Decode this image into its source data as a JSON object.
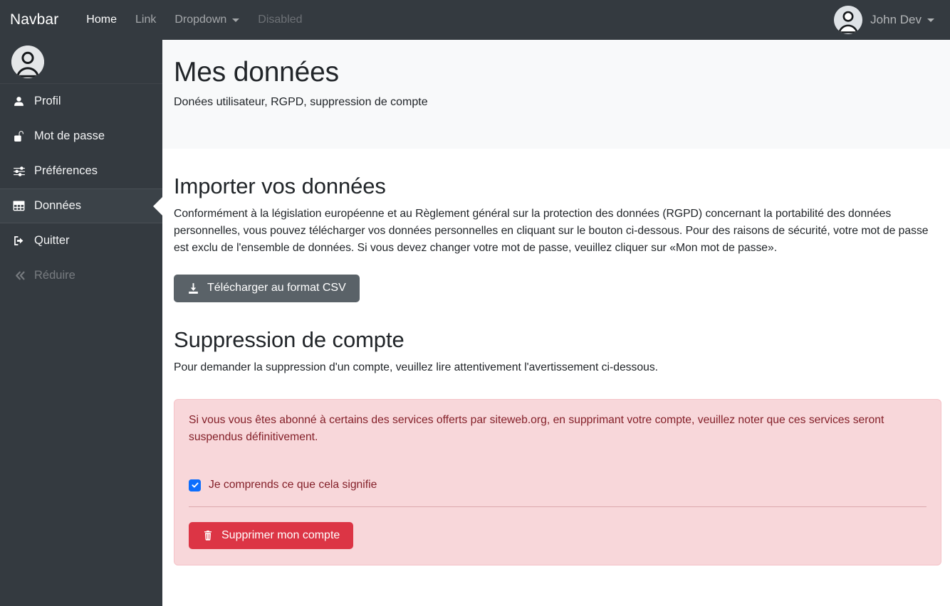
{
  "navbar": {
    "brand": "Navbar",
    "links": [
      {
        "label": "Home",
        "state": "active",
        "icon": ""
      },
      {
        "label": "Link",
        "state": "normal",
        "icon": ""
      },
      {
        "label": "Dropdown",
        "state": "normal",
        "icon": "chevron-down-icon"
      },
      {
        "label": "Disabled",
        "state": "disabled",
        "icon": ""
      }
    ],
    "user": {
      "name": "John Dev",
      "avatar_icon": "user-avatar-icon",
      "caret_icon": "chevron-down-icon"
    }
  },
  "sidebar": {
    "avatar_icon": "user-avatar-icon",
    "items": [
      {
        "label": "Profil",
        "icon": "user-icon",
        "state": "normal"
      },
      {
        "label": "Mot de passe",
        "icon": "unlock-icon",
        "state": "normal"
      },
      {
        "label": "Préférences",
        "icon": "sliders-icon",
        "state": "normal"
      },
      {
        "label": "Données",
        "icon": "table-icon",
        "state": "active"
      },
      {
        "label": "Quitter",
        "icon": "sign-out-icon",
        "state": "normal"
      },
      {
        "label": "Réduire",
        "icon": "chevron-double-left-icon",
        "state": "muted"
      }
    ]
  },
  "page": {
    "title": "Mes données",
    "subtitle": "Donées utilisateur, RGPD, suppression de compte"
  },
  "import_section": {
    "title": "Importer vos données",
    "paragraph": "Conformément à la législation européenne et au Règlement général sur la protection des données (RGPD) concernant la portabilité des données personnelles, vous pouvez télécharger vos données personnelles en cliquant sur le bouton ci-dessous. Pour des raisons de sécurité, votre mot de passe est exclu de l'ensemble de données. Si vous devez changer votre mot de passe, veuillez cliquer sur «Mon mot de passe».",
    "download_button": {
      "label": "Télécharger au format CSV",
      "icon": "download-icon",
      "color": "#5a6268"
    }
  },
  "delete_section": {
    "title": "Suppression de compte",
    "paragraph": "Pour demander la suppression d'un compte, veuillez lire attentivement l'avertissement ci-dessous.",
    "alert": {
      "text": "Si vous vous êtes abonné à certains des services offerts par siteweb.org, en supprimant votre compte, veuillez noter que ces services seront suspendus définitivement.",
      "background": "#f8d7da",
      "border": "#f5c2c7",
      "text_color": "#842029",
      "checkbox": {
        "label": "Je comprends ce que cela signifie",
        "checked": true,
        "color": "#0d6efd"
      },
      "delete_button": {
        "label": "Supprimer mon compte",
        "icon": "trash-icon",
        "color": "#dc3545"
      }
    }
  },
  "theme": {
    "navbar_bg": "#343a40",
    "sidebar_bg": "#343a40",
    "sidebar_active_bg": "#3b4248",
    "page_head_bg": "#f8f9fa",
    "body_text": "#212529"
  }
}
